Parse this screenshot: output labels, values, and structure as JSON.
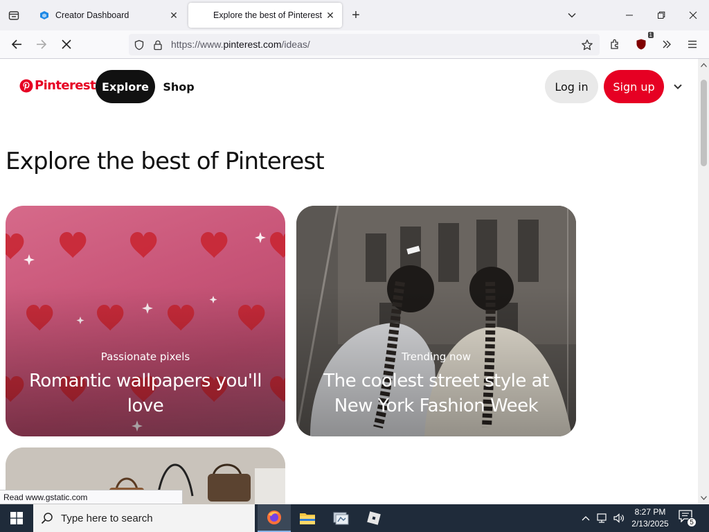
{
  "browser": {
    "tabs": [
      {
        "title": "Creator Dashboard",
        "active": false
      },
      {
        "title": "Explore the best of Pinterest",
        "active": true
      }
    ],
    "url": {
      "scheme": "https://www.",
      "host": "pinterest.com",
      "path": "/ideas/"
    },
    "extension_badge": "1"
  },
  "header": {
    "logo_text": "Pinterest",
    "nav": {
      "explore": "Explore",
      "shop": "Shop"
    },
    "login": "Log in",
    "signup": "Sign up"
  },
  "main": {
    "title": "Explore the best of Pinterest",
    "cards": [
      {
        "kicker": "Passionate pixels",
        "heading": "Romantic wallpapers you'll love"
      },
      {
        "kicker": "Trending now",
        "heading": "The coolest street style at New York Fashion Week"
      }
    ]
  },
  "status_bar": "Read www.gstatic.com",
  "taskbar": {
    "search_placeholder": "Type here to search",
    "time": "8:27 PM",
    "date": "2/13/2025",
    "notification_count": "5"
  },
  "colors": {
    "brand": "#e60023",
    "explore_pill": "#111111",
    "taskbar": "#1f2b3a"
  },
  "icons": [
    "tab-list-icon",
    "dashboard-favicon-icon",
    "close-icon",
    "plus-icon",
    "chevron-down-icon",
    "minimize-icon",
    "restore-icon",
    "close-window-icon",
    "back-arrow-icon",
    "forward-arrow-icon",
    "stop-loading-icon",
    "shield-icon",
    "lock-icon",
    "star-icon",
    "extensions-icon",
    "ublock-icon",
    "overflow-icon",
    "menu-icon",
    "pinterest-logo-icon",
    "windows-start-icon",
    "search-icon",
    "firefox-icon",
    "file-explorer-icon",
    "app-icon",
    "roblox-icon",
    "chevron-up-icon",
    "network-icon",
    "volume-icon",
    "notification-icon"
  ]
}
